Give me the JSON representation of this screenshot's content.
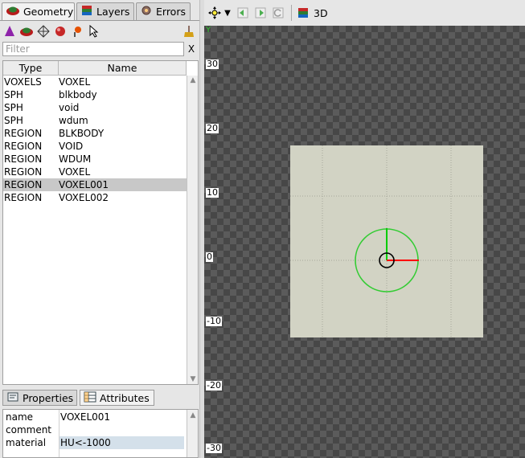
{
  "left_tabs": [
    {
      "label": "Geometry",
      "icon": "geometry-icon",
      "active": true
    },
    {
      "label": "Layers",
      "icon": "layers-icon",
      "active": false
    },
    {
      "label": "Errors",
      "icon": "errors-icon",
      "active": false
    }
  ],
  "filter": {
    "placeholder": "Filter",
    "clear_label": "X"
  },
  "table": {
    "headers": {
      "type": "Type",
      "name": "Name"
    },
    "rows": [
      {
        "type": "VOXELS",
        "name": "VOXEL"
      },
      {
        "type": "SPH",
        "name": "blkbody"
      },
      {
        "type": "SPH",
        "name": "void"
      },
      {
        "type": "SPH",
        "name": "wdum"
      },
      {
        "type": "REGION",
        "name": "BLKBODY"
      },
      {
        "type": "REGION",
        "name": "VOID"
      },
      {
        "type": "REGION",
        "name": "WDUM"
      },
      {
        "type": "REGION",
        "name": "VOXEL"
      },
      {
        "type": "REGION",
        "name": "VOXEL001"
      },
      {
        "type": "REGION",
        "name": "VOXEL002"
      }
    ],
    "selected_index": 8
  },
  "bottom_tabs": [
    {
      "label": "Properties",
      "icon": "properties-icon",
      "active": false
    },
    {
      "label": "Attributes",
      "icon": "attributes-icon",
      "active": true
    }
  ],
  "attributes": [
    {
      "key": "name",
      "value": "VOXEL001"
    },
    {
      "key": "comment",
      "value": ""
    },
    {
      "key": "material",
      "value": "HU<-1000"
    }
  ],
  "viewport": {
    "view_label": "3D",
    "axis_letter": "Y",
    "y_ticks": [
      "30",
      "20",
      "10",
      "0",
      "-10",
      "-20",
      "-30"
    ],
    "colors": {
      "plane": "#d2d3c4",
      "circle": "#33cc33",
      "x_axis": "#ff0000",
      "y_axis": "#00cc00"
    }
  }
}
